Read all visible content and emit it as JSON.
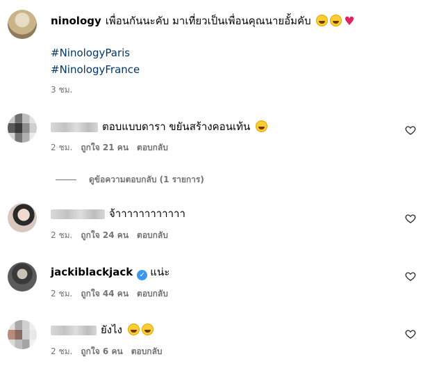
{
  "caption": {
    "username": "ninology",
    "text": "เพื่อนกันนะคับ มาเที่ยวเป็นเพื่อนคุณนายอั้มคับ",
    "hashtags": [
      "#NinologyParis",
      "#NinologyFrance"
    ],
    "time": "3 ชม."
  },
  "comments": [
    {
      "username": "",
      "blurred": true,
      "text": "ตอบแบบดารา ขยันสร้างคอนเท้น",
      "time": "2 ชม.",
      "likes": "ถูกใจ 21 คน",
      "reply": "ตอบกลับ"
    },
    {
      "username": "",
      "blurred": true,
      "text": "จ้าาาาาาาาาาาา",
      "time": "2 ชม.",
      "likes": "ถูกใจ 24 คน",
      "reply": "ตอบกลับ"
    },
    {
      "username": "jackiblackjack",
      "blurred": false,
      "verified": true,
      "text": "แน่ะ",
      "time": "2 ชม.",
      "likes": "ถูกใจ 44 คน",
      "reply": "ตอบกลับ"
    },
    {
      "username": "",
      "blurred": true,
      "text": "ยังไง",
      "time": "2 ชม.",
      "likes": "ถูกใจ 6 คน",
      "reply": "ตอบกลับ"
    }
  ],
  "view_replies": "ดูข้อความตอบกลับ (1 รายการ)",
  "icons": {
    "like": "heart-outline-icon",
    "verified": "verified-badge-icon"
  },
  "colors": {
    "hashtag": "#00376b",
    "meta": "#737373",
    "verified": "#3897f0",
    "heart": "#e0245e"
  }
}
